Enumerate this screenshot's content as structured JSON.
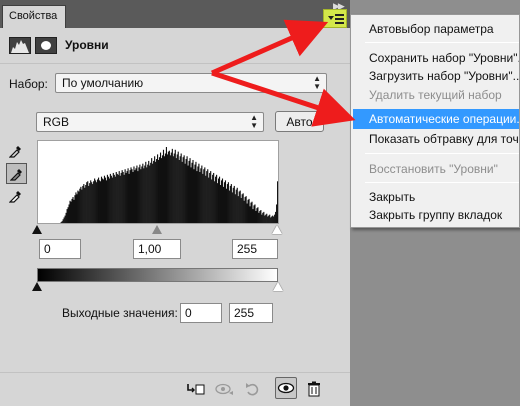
{
  "panel": {
    "tab_label": "Свойства",
    "collapse_icon": "double-chevron-right-icon",
    "menu_icon": "panel-menu-icon",
    "title": "Уровни",
    "preset": {
      "label": "Набор:",
      "value": "По умолчанию"
    },
    "channel": {
      "value": "RGB"
    },
    "auto_label": "Авто",
    "input_levels": {
      "black": "0",
      "gamma": "1,00",
      "white": "255"
    },
    "output": {
      "label": "Выходные значения:",
      "black": "0",
      "white": "255"
    },
    "footer_icons": [
      "clip-to-layer-icon",
      "view-previous-icon",
      "reset-icon",
      "visibility-eye-icon",
      "trash-icon"
    ],
    "eyedropper_icons": [
      "black-point-eyedropper-icon",
      "gray-point-eyedropper-icon",
      "white-point-eyedropper-icon"
    ]
  },
  "menu": {
    "items": [
      {
        "label": "Автовыбор параметра",
        "enabled": true
      },
      {
        "label": "Сохранить набор \"Уровни\"...",
        "enabled": true
      },
      {
        "label": "Загрузить набор \"Уровни\"...",
        "enabled": true
      },
      {
        "label": "Удалить текущий набор",
        "enabled": false
      },
      {
        "label": "Автоматические операции...",
        "enabled": true,
        "highlighted": true
      },
      {
        "label": "Показать обтравку для точек",
        "enabled": true
      },
      {
        "label": "Восстановить \"Уровни\"",
        "enabled": false
      },
      {
        "label": "Закрыть",
        "enabled": true
      },
      {
        "label": "Закрыть группу вкладок",
        "enabled": true
      }
    ]
  },
  "histogram": {
    "values": [
      0,
      0,
      0,
      0,
      0,
      0,
      0,
      0,
      0,
      0,
      0,
      0,
      0,
      0,
      0,
      0,
      0,
      0,
      0,
      0,
      0,
      0,
      0,
      1,
      2,
      4,
      6,
      8,
      11,
      15,
      17,
      20,
      24,
      23,
      26,
      28,
      25,
      30,
      33,
      31,
      35,
      34,
      37,
      39,
      36,
      40,
      42,
      38,
      41,
      44,
      45,
      40,
      43,
      46,
      44,
      42,
      45,
      48,
      46,
      44,
      47,
      49,
      46,
      45,
      50,
      48,
      47,
      51,
      49,
      46,
      52,
      50,
      48,
      53,
      51,
      49,
      54,
      52,
      50,
      55,
      53,
      52,
      56,
      51,
      54,
      57,
      55,
      52,
      58,
      54,
      56,
      59,
      53,
      57,
      60,
      58,
      55,
      61,
      57,
      59,
      62,
      56,
      60,
      63,
      58,
      61,
      64,
      59,
      62,
      66,
      60,
      63,
      67,
      62,
      65,
      70,
      64,
      67,
      72,
      66,
      69,
      74,
      68,
      71,
      76,
      70,
      73,
      79,
      72,
      75,
      82,
      74,
      77,
      78,
      73,
      76,
      80,
      72,
      75,
      79,
      70,
      74,
      77,
      68,
      72,
      75,
      66,
      71,
      73,
      64,
      69,
      72,
      62,
      67,
      70,
      60,
      65,
      68,
      58,
      63,
      66,
      56,
      61,
      64,
      55,
      59,
      62,
      53,
      58,
      60,
      51,
      56,
      58,
      49,
      54,
      56,
      47,
      52,
      54,
      45,
      50,
      52,
      43,
      48,
      50,
      41,
      46,
      48,
      39,
      44,
      46,
      37,
      42,
      44,
      35,
      40,
      42,
      33,
      38,
      40,
      31,
      36,
      38,
      29,
      34,
      35,
      27,
      31,
      32,
      24,
      28,
      29,
      21,
      25,
      26,
      18,
      22,
      23,
      15,
      19,
      20,
      13,
      16,
      17,
      11,
      13,
      14,
      9,
      11,
      12,
      8,
      9,
      10,
      7,
      8,
      9,
      6,
      7,
      8,
      7,
      9,
      12,
      20,
      45
    ],
    "ymax": 82
  },
  "colors": {
    "menu_highlight": "#3399ff",
    "menu_button": "#d4e84a",
    "arrow": "#ee1c1c",
    "panel_bg": "#d6d6d6"
  }
}
